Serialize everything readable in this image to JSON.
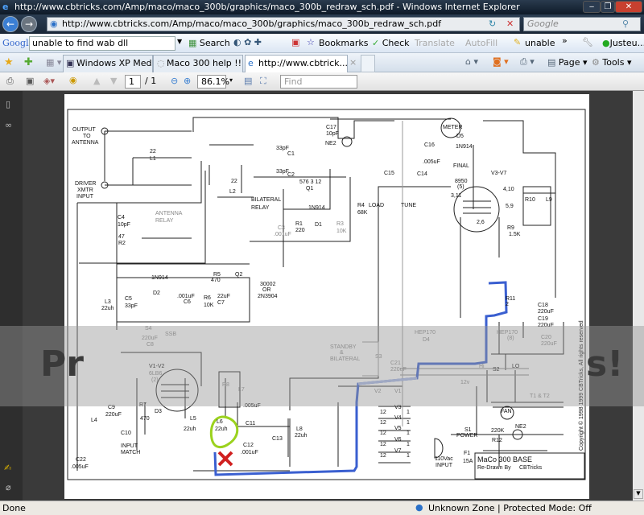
{
  "window": {
    "title": "http://www.cbtricks.com/Amp/maco/maco_300b/graphics/maco_300b_redraw_sch.pdf - Windows Internet Explorer",
    "minimize": "‒",
    "restore": "❐",
    "close": "✕"
  },
  "address": {
    "url": "http://www.cbtricks.com/Amp/maco/maco_300b/graphics/maco_300b_redraw_sch.pdf",
    "search_placeholder": "Google",
    "back": "←",
    "forward": "→"
  },
  "google_toolbar": {
    "logo": "Google",
    "query": "unable to find wab dll",
    "search": "Search",
    "bookmarks": "Bookmarks",
    "check": "Check",
    "translate": "Translate",
    "autofill": "AutoFill",
    "highlight": "unable",
    "more": "»",
    "account": "Justeu..."
  },
  "tabs": {
    "items": [
      {
        "label": "Windows XP Media C..."
      },
      {
        "label": "Maco 300 help !!"
      },
      {
        "label": "http://www.cbtrick..."
      }
    ],
    "close": "×",
    "page": "Page",
    "tools": "Tools"
  },
  "pdf_toolbar": {
    "page_current": "1",
    "page_total": "/ 1",
    "zoom": "86.1%",
    "find_placeholder": "Find"
  },
  "overlay": {
    "left_text": "Pr",
    "right_text": "s!"
  },
  "status": {
    "text": "Done",
    "zone": "Unknown Zone | Protected Mode: Off"
  },
  "colors": {
    "highlight_blue": "#3a5fd0",
    "highlight_green": "#9bd21e",
    "mark_red": "#d02020"
  },
  "schematic": {
    "labels": [
      "OUTPUT",
      "TO",
      "ANTENNA",
      "DRIVER",
      "XMTR",
      "INPUT",
      "22",
      "L1",
      "22",
      "L2",
      "33pF",
      "C1",
      "33pF",
      "C2",
      "576 3 12",
      "Q1",
      "BILATERAL",
      "RELAY",
      "ANTENNA",
      "RELAY",
      "C4",
      "10pF",
      "47",
      "R2",
      "1N914",
      "D1",
      "R1",
      "220",
      "C3",
      ".001uF",
      "R3",
      "10K",
      "R4",
      "68K",
      "C17",
      "10pF",
      "NE2",
      "LOAD",
      "TUNE",
      "C15",
      "C14",
      "C16",
      ".005uF",
      "METER",
      "D5",
      "1N914",
      "FINAL",
      "V3-V7",
      "8950",
      "(5)",
      "3,11",
      "4,10",
      "5,9",
      "2,6",
      "R10",
      "L9",
      "R9",
      "1.5K",
      "1N914",
      "D2",
      "R5",
      "470",
      "Q2",
      "30002",
      "OR",
      "2N3904",
      "L3",
      "22uh",
      "C5",
      "33pF",
      ".001uF",
      "C6",
      "R6",
      "10K",
      "22uF",
      "C7",
      "R11",
      "2",
      "C18",
      "220uF",
      "C19",
      "220uF",
      "S4",
      "SSB",
      "220uF",
      "C8",
      "HEP170",
      "D4",
      "HEP170",
      "(8)",
      "C20",
      "220uF",
      "STANDBY",
      "&",
      "BILATERAL",
      "S3",
      "C21",
      "220uF",
      "Hi",
      "S2",
      "LO",
      "V1-V2",
      "6LB6",
      "(2)",
      "R8",
      "L7",
      "V2",
      "V1",
      "12v",
      "T1 & T2",
      "C9",
      "220uF",
      "R7",
      "470",
      "D3",
      ".005uF",
      "C11",
      "L4",
      "C10",
      "INPUT",
      "MATCH",
      "L5",
      "22uh",
      "L6",
      "22uh",
      "C13",
      "L8",
      "22uh",
      "C12",
      ".001uF",
      "C22",
      ".005uF",
      "V3",
      "V4",
      "V5",
      "V6",
      "V7",
      "FAN",
      "S1",
      "POWER",
      "220K",
      "R12",
      "NE2",
      "110Vac",
      "INPUT",
      "F1",
      "15A"
    ],
    "filament_value_left": "12",
    "filament_value_right": "1",
    "title": "MaCo 300  BASE",
    "redrawn": "Re-Drawn By",
    "author": "CBTricks",
    "copyright": "Copyright © 1998  1999  CBTricks, All rights reserved"
  }
}
